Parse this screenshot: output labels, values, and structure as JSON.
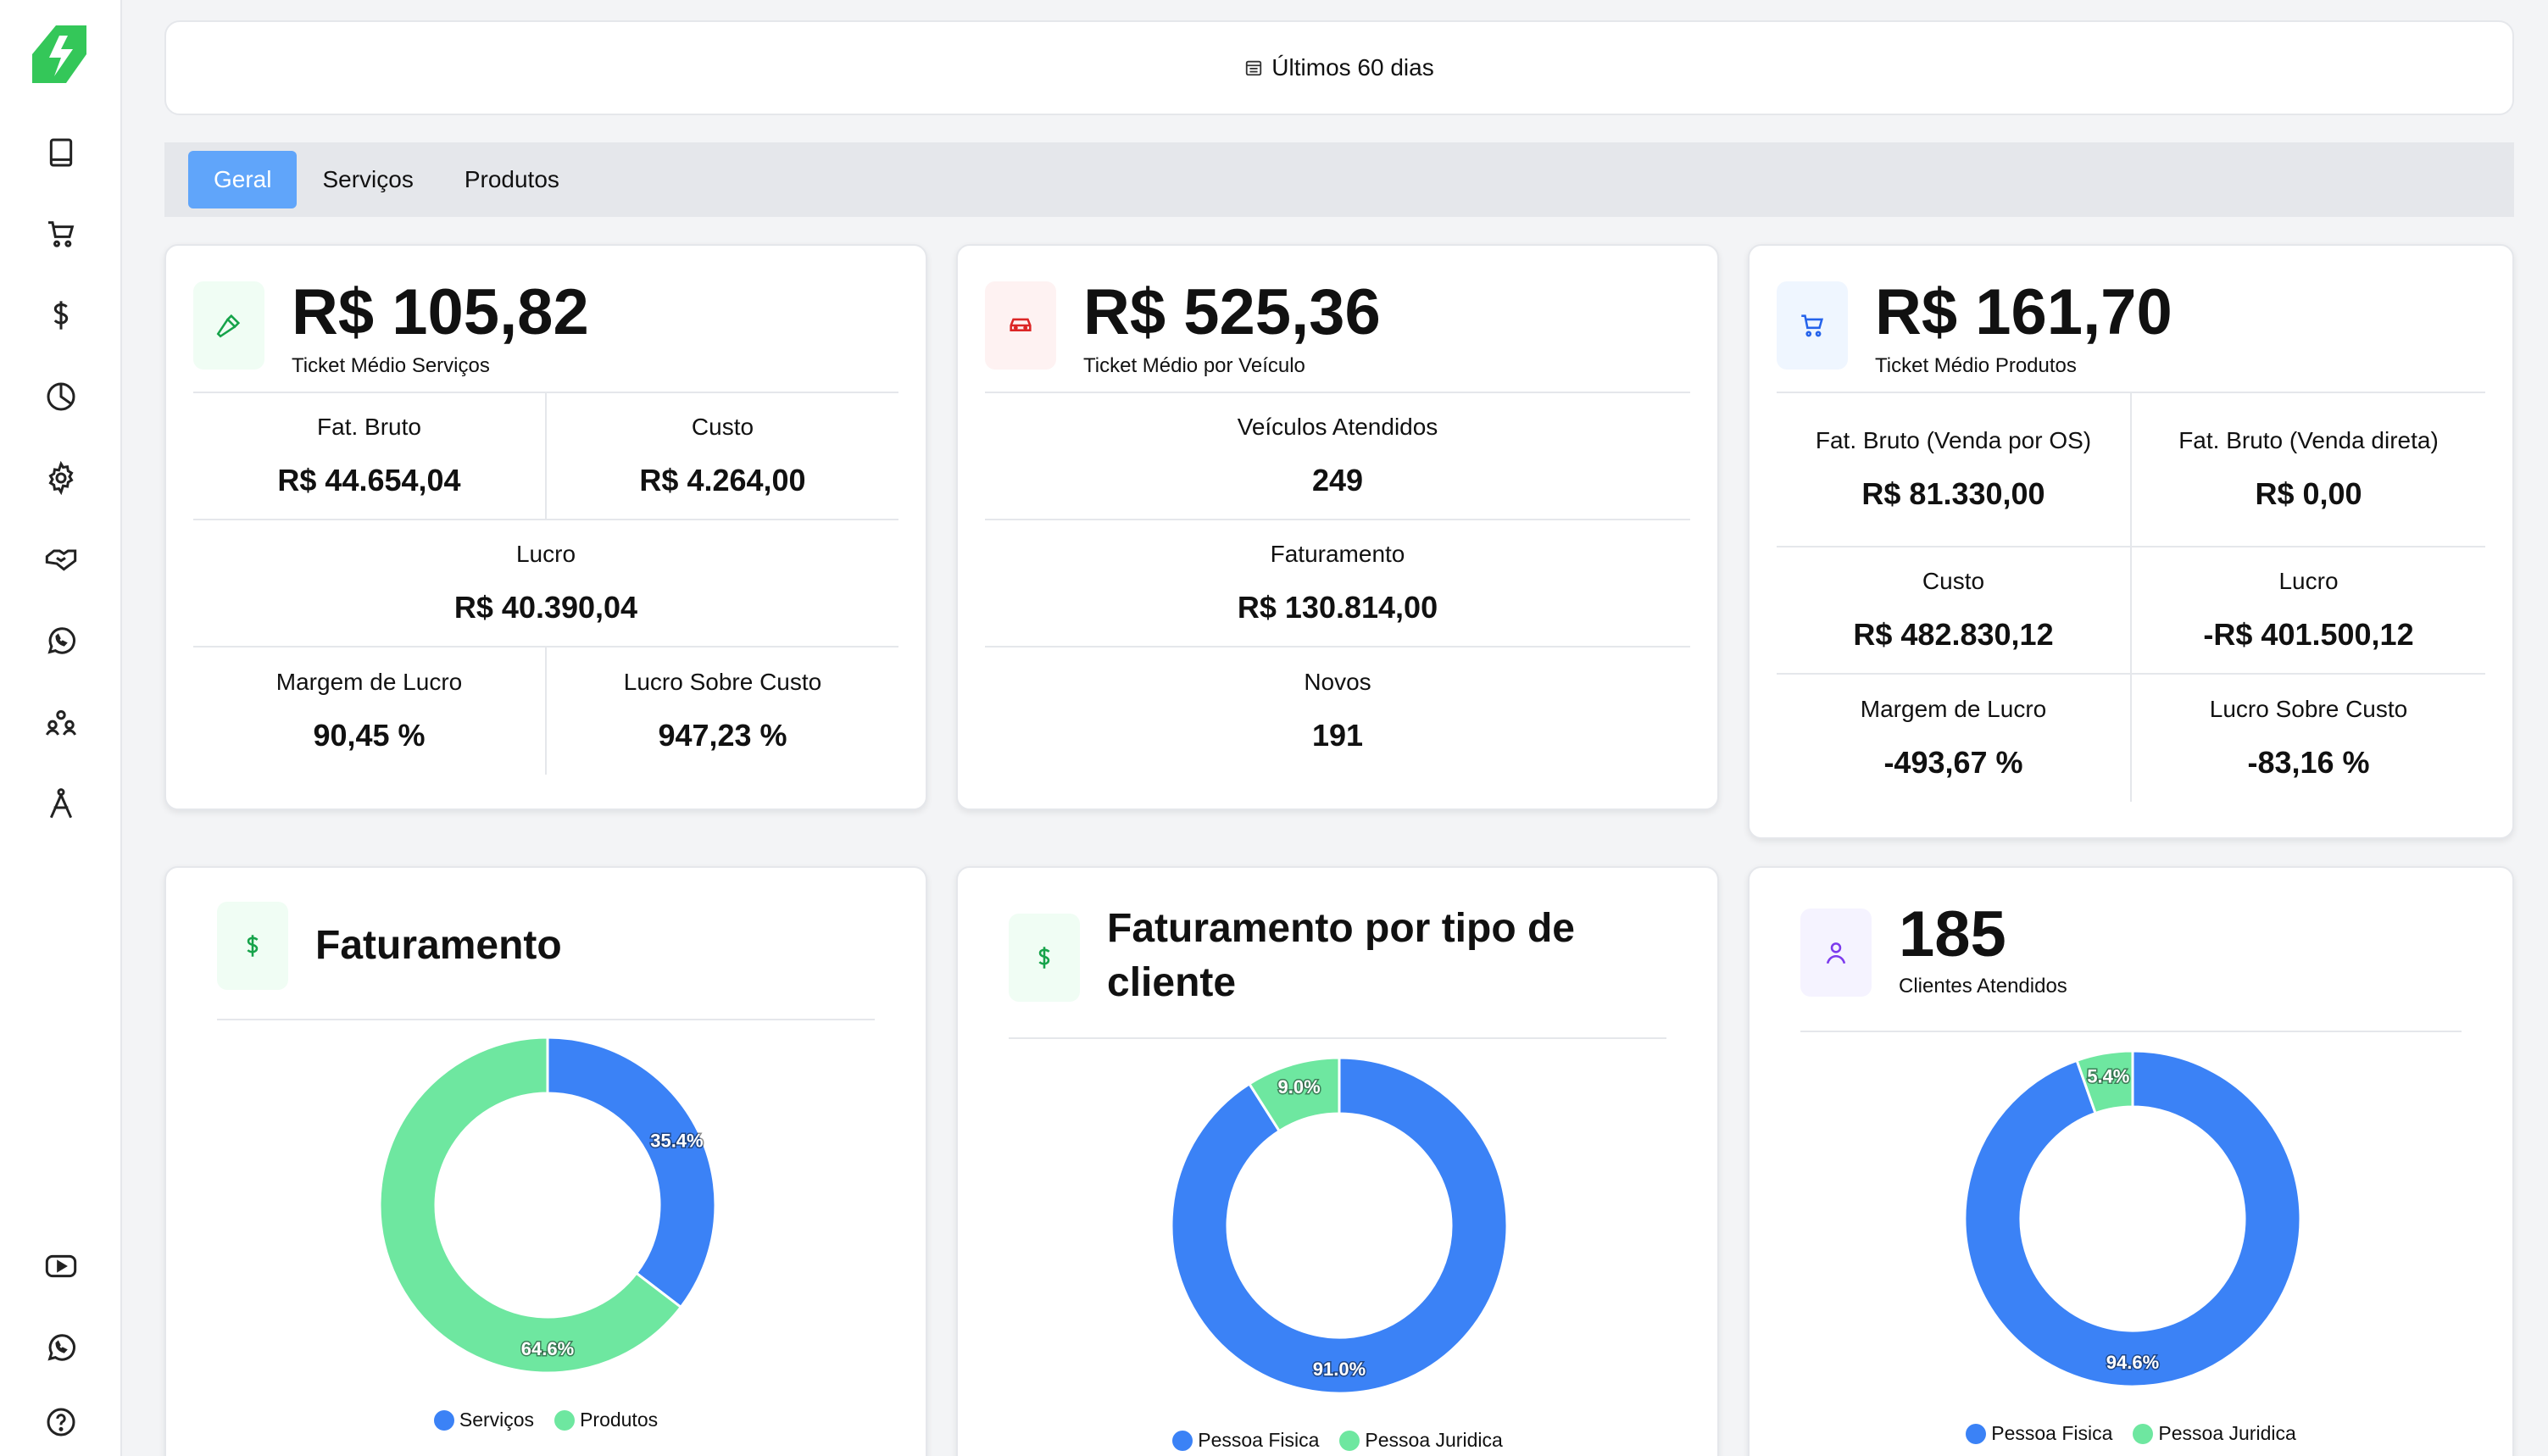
{
  "date_filter": {
    "label": "Últimos 60 dias",
    "icon": "calendar-icon"
  },
  "tabs": [
    {
      "label": "Geral",
      "active": true
    },
    {
      "label": "Serviços",
      "active": false
    },
    {
      "label": "Produtos",
      "active": false
    }
  ],
  "sidebar": {
    "items": [
      "book-icon",
      "cart-icon",
      "dollar-icon",
      "pie-chart-icon",
      "gear-icon",
      "handshake-icon",
      "whatsapp-icon",
      "users-icon",
      "compass-icon"
    ],
    "bottom": [
      "youtube-icon",
      "whatsapp-icon",
      "help-icon"
    ]
  },
  "cards": {
    "servicos": {
      "value": "R$ 105,82",
      "label": "Ticket Médio Serviços",
      "stats": {
        "fat_bruto_label": "Fat. Bruto",
        "fat_bruto": "R$ 44.654,04",
        "custo_label": "Custo",
        "custo": "R$ 4.264,00",
        "lucro_label": "Lucro",
        "lucro": "R$ 40.390,04",
        "margem_label": "Margem de Lucro",
        "margem": "90,45 %",
        "lsc_label": "Lucro Sobre Custo",
        "lsc": "947,23 %"
      }
    },
    "veiculo": {
      "value": "R$ 525,36",
      "label": "Ticket Médio por Veículo",
      "stats": {
        "atendidos_label": "Veículos Atendidos",
        "atendidos": "249",
        "faturamento_label": "Faturamento",
        "faturamento": "R$ 130.814,00",
        "novos_label": "Novos",
        "novos": "191"
      }
    },
    "produtos": {
      "value": "R$ 161,70",
      "label": "Ticket Médio Produtos",
      "stats": {
        "fat_os_label": "Fat. Bruto (Venda por OS)",
        "fat_os": "R$ 81.330,00",
        "fat_direta_label": "Fat. Bruto (Venda direta)",
        "fat_direta": "R$ 0,00",
        "custo_label": "Custo",
        "custo": "R$ 482.830,12",
        "lucro_label": "Lucro",
        "lucro": "-R$ 401.500,12",
        "margem_label": "Margem de Lucro",
        "margem": "-493,67 %",
        "lsc_label": "Lucro Sobre Custo",
        "lsc": "-83,16 %"
      }
    }
  },
  "chart_data": [
    {
      "type": "pie",
      "title": "Faturamento",
      "categories": [
        "Serviços",
        "Produtos"
      ],
      "values": [
        35.4,
        64.6
      ],
      "labels": [
        "35.4%",
        "64.6%"
      ],
      "colors": [
        "#3b82f6",
        "#6ee7a0"
      ],
      "legend": "bottom"
    },
    {
      "type": "pie",
      "title": "Faturamento por tipo de cliente",
      "categories": [
        "Pessoa Fisica",
        "Pessoa Juridica"
      ],
      "values": [
        91.0,
        9.0
      ],
      "labels": [
        "91.0%",
        "9.0%"
      ],
      "colors": [
        "#3b82f6",
        "#6ee7a0"
      ],
      "legend": "bottom"
    },
    {
      "type": "pie",
      "title": "Clientes Atendidos",
      "headline": "185",
      "categories": [
        "Pessoa Fisica",
        "Pessoa Juridica"
      ],
      "values": [
        94.6,
        5.4
      ],
      "labels": [
        "94.6%",
        "5.4%"
      ],
      "colors": [
        "#3b82f6",
        "#6ee7a0"
      ],
      "legend": "bottom"
    }
  ],
  "colors": {
    "accent": "#60a5fa",
    "green": "#6ee7a0",
    "blue": "#3b82f6",
    "logo": "#34c759"
  }
}
